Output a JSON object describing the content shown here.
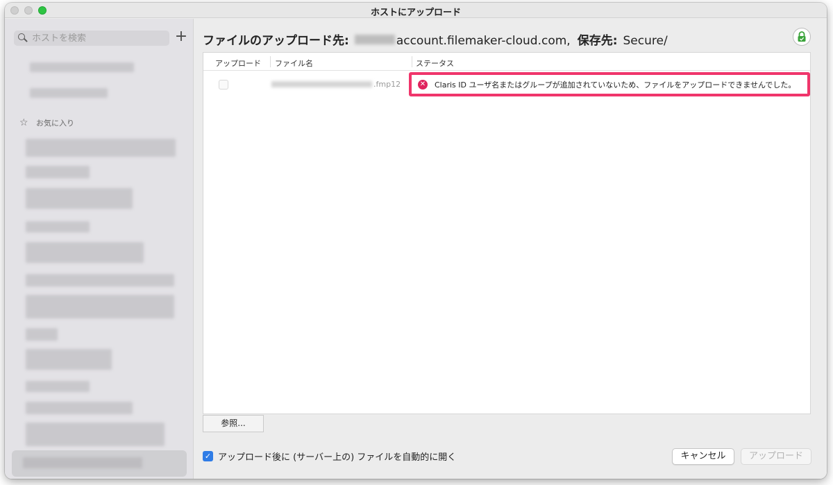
{
  "window": {
    "title": "ホストにアップロード"
  },
  "sidebar": {
    "search_placeholder": "ホストを検索",
    "add_label": "+",
    "favorites_label": "お気に入り"
  },
  "header": {
    "prefix": "ファイルのアップロード先:",
    "host": "account.filemaker-cloud.com,",
    "save_label": "保存先:",
    "save_path": "Secure/"
  },
  "table": {
    "columns": [
      "アップロード",
      "ファイル名",
      "ステータス"
    ],
    "rows": [
      {
        "file_suffix": ".fmp12",
        "status_message": "Claris ID ユーザ名またはグループが追加されていないため、ファイルをアップロードできませんでした。"
      }
    ]
  },
  "buttons": {
    "browse": "参照...",
    "cancel": "キャンセル",
    "upload": "アップロード"
  },
  "options": {
    "open_after_upload": "アップロード後に (サーバー上の) ファイルを自動的に開く"
  },
  "colors": {
    "highlight_border": "#f0356b",
    "error_icon": "#e0245e",
    "checkbox_blue": "#2f7ce6",
    "lock_green": "#3aa33a"
  },
  "icons": [
    "search-icon",
    "plus-icon",
    "star-icon",
    "lock-icon",
    "error-icon",
    "checkmark-icon"
  ]
}
